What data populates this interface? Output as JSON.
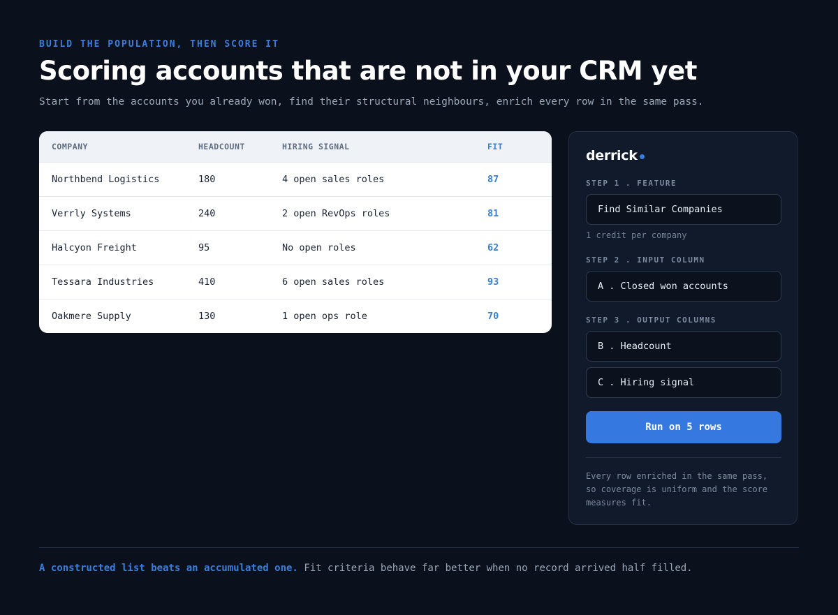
{
  "header": {
    "eyebrow": "BUILD THE POPULATION, THEN SCORE IT",
    "title": "Scoring accounts that are not in your CRM yet",
    "subtitle": "Start from the accounts you already won, find their structural neighbours, enrich every row in the same pass."
  },
  "table": {
    "columns": [
      "COMPANY",
      "HEADCOUNT",
      "HIRING SIGNAL",
      "FIT"
    ],
    "rows": [
      {
        "company": "Northbend Logistics",
        "headcount": "180",
        "hiring": "4 open sales roles",
        "fit": "87"
      },
      {
        "company": "Verrly Systems",
        "headcount": "240",
        "hiring": "2 open RevOps roles",
        "fit": "81"
      },
      {
        "company": "Halcyon Freight",
        "headcount": "95",
        "hiring": "No open roles",
        "fit": "62"
      },
      {
        "company": "Tessara Industries",
        "headcount": "410",
        "hiring": "6 open sales roles",
        "fit": "93"
      },
      {
        "company": "Oakmere Supply",
        "headcount": "130",
        "hiring": "1 open ops role",
        "fit": "70"
      }
    ]
  },
  "panel": {
    "brand": "derrick",
    "step1_label": "STEP 1 . FEATURE",
    "step1_value": "Find Similar Companies",
    "step1_note": "1 credit per company",
    "step2_label": "STEP 2 . INPUT COLUMN",
    "step2_value": "A . Closed won accounts",
    "step3_label": "STEP 3 . OUTPUT COLUMNS",
    "step3_values": [
      "B . Headcount",
      "C . Hiring signal"
    ],
    "run_label": "Run on 5 rows",
    "footnote": "Every row enriched in the same pass, so coverage is uniform and the score measures fit."
  },
  "footer": {
    "lead": "A constructed list beats an accumulated one.",
    "rest": "Fit criteria behave far better when no record arrived half filled."
  },
  "colors": {
    "accent": "#3b7ddd",
    "background": "#0b111c",
    "panel": "#111a2a"
  }
}
